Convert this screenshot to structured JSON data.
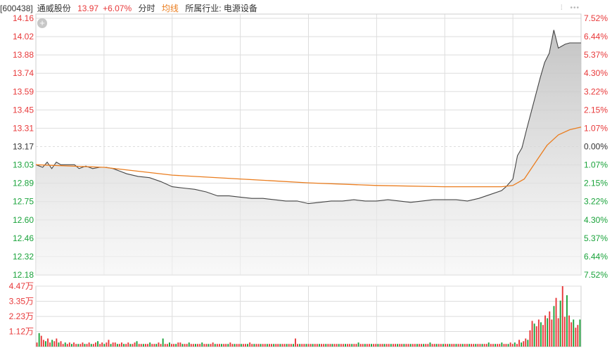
{
  "header": {
    "code": "[600438]",
    "name": "通威股份",
    "price": "13.97",
    "change": "+6.07%",
    "tab_timeshare": "分时",
    "tab_avg": "均线",
    "industry": "所属行业: 电源设备",
    "icons": [
      "drag-handle-icon",
      "more-icon"
    ]
  },
  "colors": {
    "up": "#e8393a",
    "down": "#1aa33b",
    "price_line": "#444444",
    "avg_line": "#ea7d1f",
    "grid": "#dddddd",
    "fill_top": "#bdbdbd"
  },
  "chart_data": [
    {
      "type": "line",
      "title": "",
      "y_ticks": [
        "14.16",
        "14.02",
        "13.88",
        "13.74",
        "13.59",
        "13.45",
        "13.31",
        "13.17",
        "13.03",
        "12.89",
        "12.75",
        "12.60",
        "12.46",
        "12.32",
        "12.18"
      ],
      "pct_ticks": [
        "7.52%",
        "6.44%",
        "5.37%",
        "4.30%",
        "3.22%",
        "2.15%",
        "1.07%",
        "0.00%",
        "1.07%",
        "2.15%",
        "3.22%",
        "4.30%",
        "5.37%",
        "6.44%",
        "7.52%"
      ],
      "ylim": [
        12.18,
        14.16
      ],
      "prev_close": 13.17,
      "x_count": 241,
      "series": [
        {
          "key": "price",
          "points": [
            [
              0,
              13.03
            ],
            [
              3,
              13.01
            ],
            [
              5,
              13.05
            ],
            [
              7,
              13.0
            ],
            [
              9,
              13.05
            ],
            [
              11,
              13.03
            ],
            [
              14,
              13.03
            ],
            [
              17,
              13.03
            ],
            [
              19,
              13.0
            ],
            [
              22,
              13.02
            ],
            [
              25,
              13.0
            ],
            [
              28,
              13.01
            ],
            [
              31,
              13.01
            ],
            [
              34,
              13.0
            ],
            [
              37,
              12.98
            ],
            [
              40,
              12.96
            ],
            [
              45,
              12.94
            ],
            [
              50,
              12.93
            ],
            [
              55,
              12.9
            ],
            [
              60,
              12.86
            ],
            [
              65,
              12.85
            ],
            [
              70,
              12.84
            ],
            [
              75,
              12.82
            ],
            [
              80,
              12.79
            ],
            [
              85,
              12.79
            ],
            [
              90,
              12.78
            ],
            [
              95,
              12.77
            ],
            [
              100,
              12.77
            ],
            [
              105,
              12.76
            ],
            [
              110,
              12.75
            ],
            [
              115,
              12.75
            ],
            [
              120,
              12.73
            ],
            [
              125,
              12.74
            ],
            [
              130,
              12.75
            ],
            [
              135,
              12.75
            ],
            [
              140,
              12.76
            ],
            [
              145,
              12.75
            ],
            [
              150,
              12.75
            ],
            [
              155,
              12.76
            ],
            [
              160,
              12.75
            ],
            [
              165,
              12.74
            ],
            [
              170,
              12.75
            ],
            [
              175,
              12.76
            ],
            [
              180,
              12.76
            ],
            [
              185,
              12.76
            ],
            [
              190,
              12.75
            ],
            [
              195,
              12.77
            ],
            [
              200,
              12.8
            ],
            [
              205,
              12.83
            ],
            [
              207,
              12.86
            ],
            [
              210,
              12.92
            ],
            [
              212,
              13.1
            ],
            [
              214,
              13.16
            ],
            [
              216,
              13.3
            ],
            [
              219,
              13.5
            ],
            [
              222,
              13.7
            ],
            [
              224,
              13.82
            ],
            [
              226,
              13.89
            ],
            [
              228,
              14.07
            ],
            [
              230,
              13.93
            ],
            [
              233,
              13.96
            ],
            [
              235,
              13.97
            ],
            [
              240,
              13.97
            ]
          ]
        },
        {
          "key": "avg",
          "points": [
            [
              0,
              13.03
            ],
            [
              30,
              13.01
            ],
            [
              60,
              12.95
            ],
            [
              90,
              12.92
            ],
            [
              120,
              12.89
            ],
            [
              150,
              12.87
            ],
            [
              180,
              12.86
            ],
            [
              205,
              12.86
            ],
            [
              210,
              12.87
            ],
            [
              215,
              12.92
            ],
            [
              220,
              13.05
            ],
            [
              225,
              13.18
            ],
            [
              230,
              13.26
            ],
            [
              235,
              13.3
            ],
            [
              240,
              13.32
            ]
          ]
        }
      ]
    },
    {
      "type": "bar",
      "title": "",
      "y_ticks": [
        "4.47万",
        "3.35万",
        "2.23万",
        "1.12万"
      ],
      "ylim": [
        0,
        4.47
      ],
      "unit": "万",
      "values": [
        0.3,
        1.0,
        0.8,
        0.5,
        0.4,
        0.6,
        0.3,
        0.5,
        0.4,
        0.6,
        0.3,
        0.4,
        0.2,
        0.3,
        0.2,
        0.3,
        0.2,
        0.3,
        0.2,
        0.2,
        0.2,
        0.3,
        0.2,
        0.2,
        0.3,
        0.2,
        0.2,
        0.3,
        0.4,
        0.2,
        0.3,
        0.2,
        0.3,
        0.5,
        0.2,
        0.3,
        0.3,
        0.2,
        0.2,
        0.3,
        0.2,
        0.2,
        0.3,
        0.2,
        0.2,
        0.3,
        0.4,
        0.2,
        0.2,
        0.2,
        0.2,
        0.2,
        0.3,
        0.2,
        0.2,
        0.2,
        0.3,
        0.2,
        0.6,
        0.2,
        0.2,
        0.3,
        0.2,
        0.2,
        0.2,
        0.3,
        0.3,
        0.2,
        0.2,
        0.2,
        0.3,
        0.2,
        0.2,
        0.2,
        0.2,
        0.2,
        0.3,
        0.2,
        0.2,
        0.2,
        0.2,
        0.3,
        0.2,
        0.2,
        0.2,
        0.2,
        0.2,
        0.2,
        0.2,
        0.3,
        0.2,
        0.2,
        0.2,
        0.2,
        0.2,
        0.2,
        0.2,
        0.2,
        0.3,
        0.2,
        0.2,
        0.2,
        0.2,
        0.2,
        0.2,
        0.2,
        0.2,
        0.2,
        0.2,
        0.2,
        0.2,
        0.2,
        0.2,
        0.2,
        0.2,
        0.2,
        0.2,
        0.2,
        0.2,
        0.6,
        0.2,
        0.2,
        0.2,
        0.2,
        0.2,
        0.2,
        0.2,
        0.2,
        0.2,
        0.2,
        0.2,
        0.2,
        0.2,
        0.2,
        0.2,
        0.2,
        0.2,
        0.2,
        0.2,
        0.2,
        0.2,
        0.2,
        0.2,
        0.2,
        0.2,
        0.2,
        0.2,
        0.2,
        0.3,
        0.2,
        0.2,
        0.2,
        0.2,
        0.2,
        0.2,
        0.2,
        0.2,
        0.2,
        0.2,
        0.2,
        0.2,
        0.2,
        0.2,
        0.2,
        0.2,
        0.2,
        0.2,
        0.2,
        0.2,
        0.2,
        0.2,
        0.2,
        0.2,
        0.2,
        0.2,
        0.2,
        0.2,
        0.2,
        0.2,
        0.2,
        0.2,
        0.3,
        0.2,
        0.2,
        0.2,
        0.2,
        0.2,
        0.2,
        0.2,
        0.2,
        0.2,
        0.2,
        0.2,
        0.2,
        0.2,
        0.2,
        0.2,
        0.2,
        0.2,
        0.2,
        0.2,
        0.2,
        0.2,
        0.2,
        0.2,
        0.2,
        0.2,
        0.2,
        0.3,
        0.2,
        0.2,
        0.2,
        0.2,
        0.2,
        0.3,
        0.2,
        0.2,
        0.2,
        0.3,
        0.2,
        0.3,
        0.2,
        0.5,
        0.3,
        0.4,
        0.6,
        0.5,
        1.2,
        1.9,
        1.7,
        1.5,
        2.0,
        1.8,
        1.6,
        2.3,
        2.1,
        2.6,
        2.0,
        3.0,
        3.6,
        2.1,
        3.4,
        4.47,
        2.2,
        3.8,
        2.3,
        1.8,
        2.0,
        1.4,
        1.6,
        2.0
      ]
    }
  ]
}
